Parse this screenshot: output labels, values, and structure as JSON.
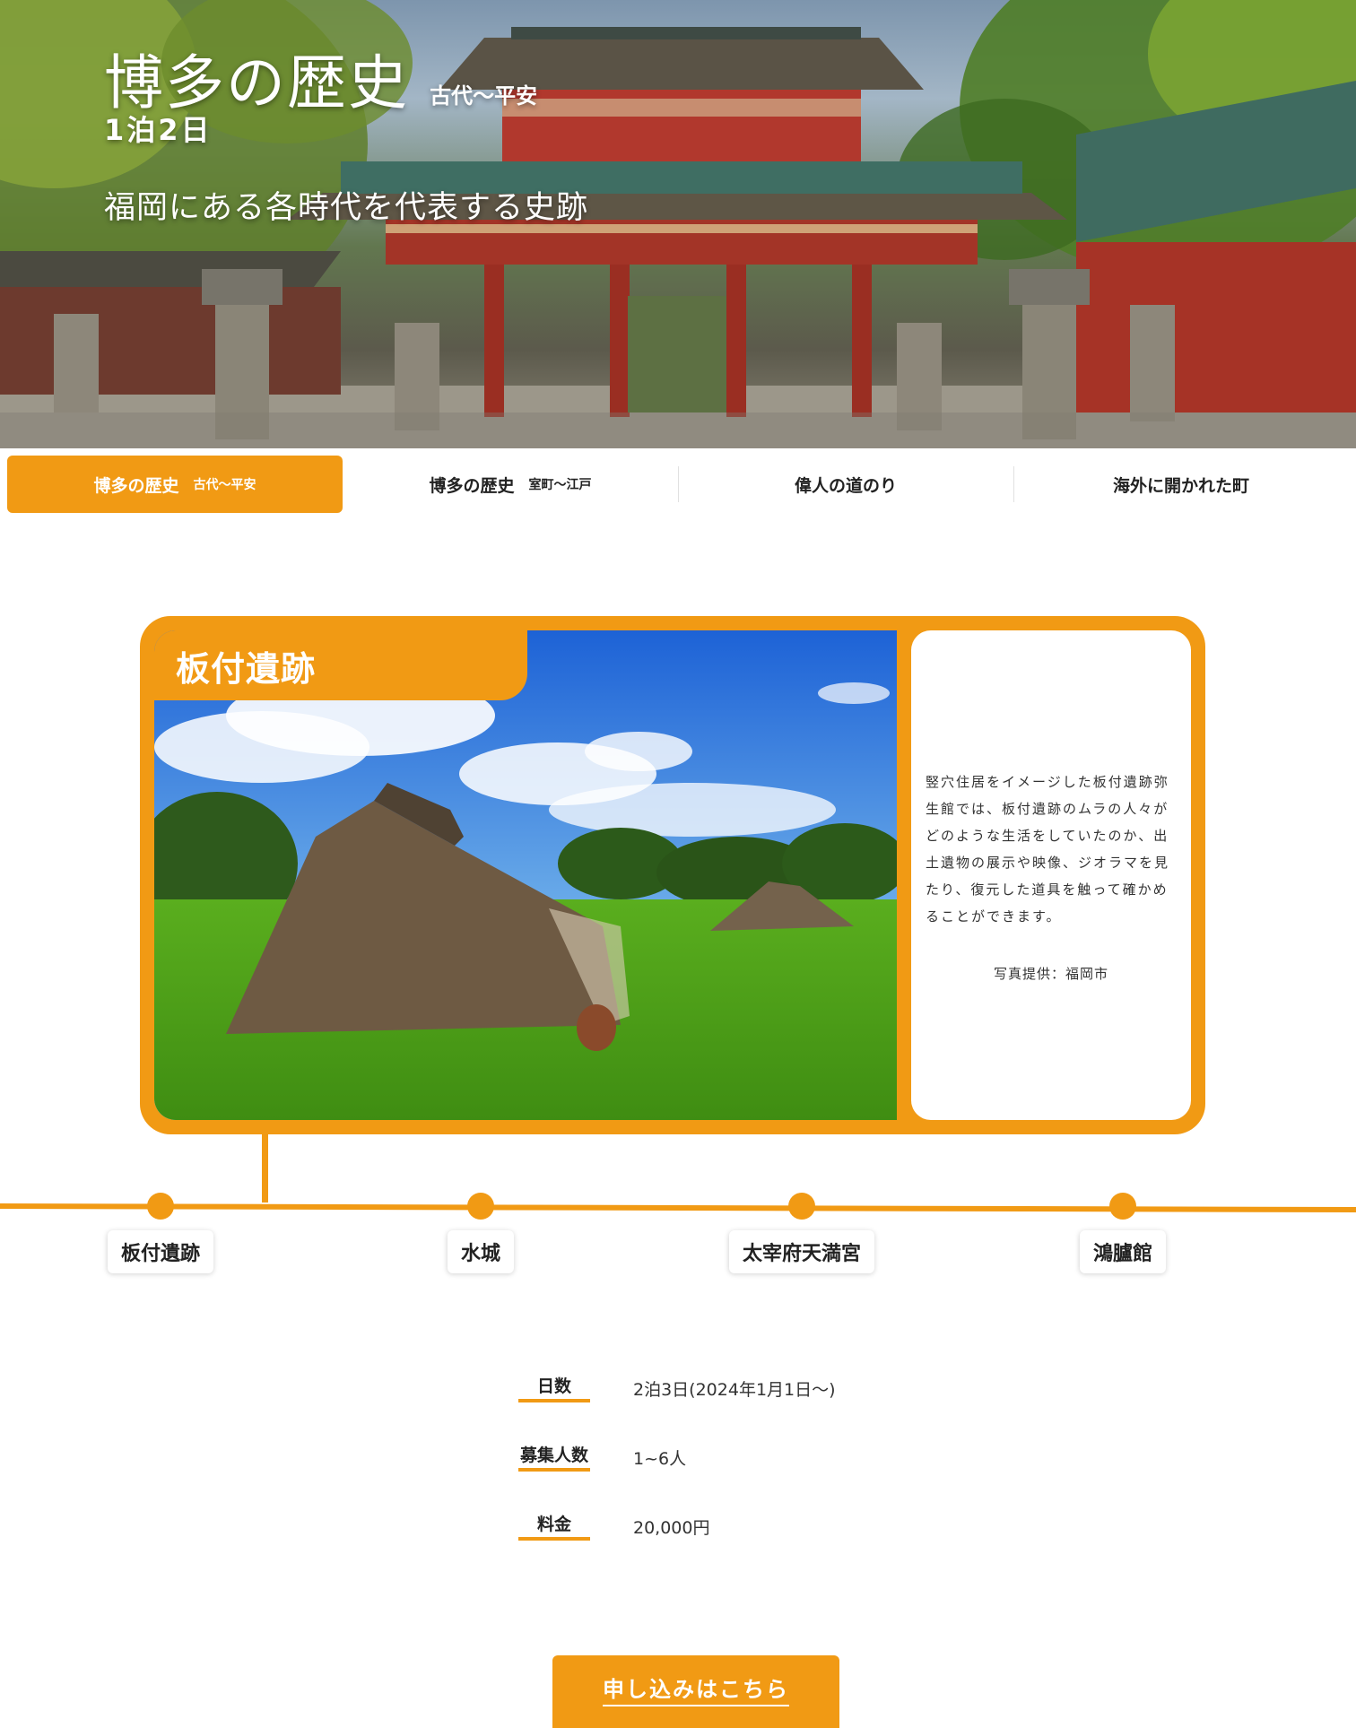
{
  "hero": {
    "title": "博多の歴史",
    "era": "古代〜平安",
    "duration": "1泊2日",
    "subtitle": "福岡にある各時代を代表する史跡",
    "image": "shrine-gate-photo"
  },
  "tabs": [
    {
      "label": "博多の歴史",
      "sub": "古代〜平安",
      "active": true
    },
    {
      "label": "博多の歴史",
      "sub": "室町〜江戸",
      "active": false
    },
    {
      "label": "偉人の道のり",
      "sub": "",
      "active": false
    },
    {
      "label": "海外に開かれた町",
      "sub": "",
      "active": false
    }
  ],
  "feature": {
    "title": "板付遺跡",
    "image": "pit-dwelling-photo",
    "description": "竪穴住居をイメージした板付遺跡弥生館では、板付遺跡のムラの人々がどのような生活をしていたのか、出土遺物の展示や映像、ジオラマを見たり、復元した道具を触って確かめることができます。",
    "credit": "写真提供：福岡市"
  },
  "timeline": {
    "stops": [
      "板付遺跡",
      "水城",
      "太宰府天満宮",
      "鴻臚館"
    ]
  },
  "details": [
    {
      "label": "日数",
      "value": "2泊3日(2024年1月1日〜)"
    },
    {
      "label": "募集人数",
      "value": "1~6人"
    },
    {
      "label": "料金",
      "value": "20,000円"
    }
  ],
  "cta": {
    "label": "申し込みはこちら"
  },
  "colors": {
    "accent": "#f19a14",
    "text": "#222222",
    "background": "#ffffff"
  }
}
